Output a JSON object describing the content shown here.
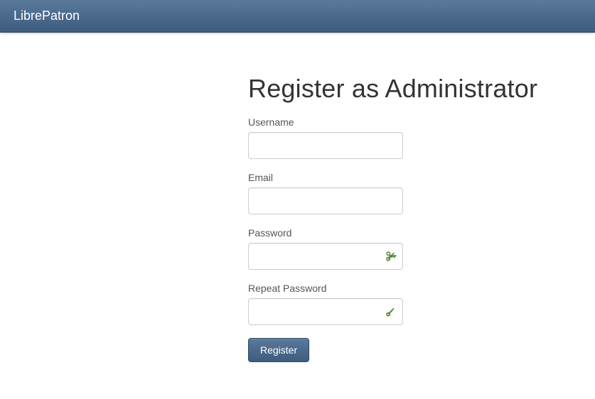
{
  "navbar": {
    "brand": "LibrePatron"
  },
  "page": {
    "title": "Register as Administrator"
  },
  "form": {
    "username": {
      "label": "Username",
      "value": ""
    },
    "email": {
      "label": "Email",
      "value": ""
    },
    "password": {
      "label": "Password",
      "value": ""
    },
    "repeat_password": {
      "label": "Repeat Password",
      "value": ""
    },
    "submit_label": "Register"
  }
}
